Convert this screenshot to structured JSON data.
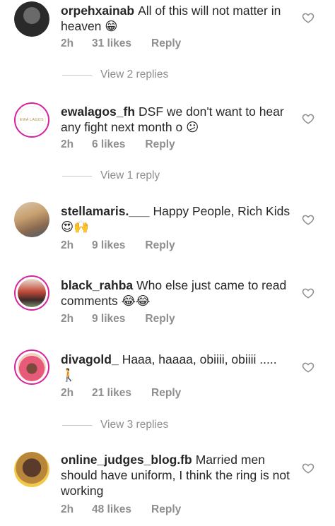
{
  "comments": [
    {
      "username": "orpehxainab",
      "text": "All of this will not matter in heaven",
      "emoji": "😁",
      "time": "2h",
      "likes": "31 likes",
      "reply": "Reply",
      "view_replies": "View 2 replies"
    },
    {
      "username": "ewalagos_fh",
      "text": "DSF we don't want to hear any fight next month o",
      "emoji": "😕",
      "avatar_text": "EWA LAGOS",
      "time": "2h",
      "likes": "6 likes",
      "reply": "Reply",
      "view_replies": "View 1 reply"
    },
    {
      "username": "stellamaris.___",
      "text": "Happy People, Rich Kids",
      "emoji": "😍🙌",
      "time": "2h",
      "likes": "9 likes",
      "reply": "Reply"
    },
    {
      "username": "black_rahba",
      "text": "Who else just came to read comments",
      "emoji": "😂😂",
      "time": "2h",
      "likes": "9 likes",
      "reply": "Reply"
    },
    {
      "username": "divagold_",
      "text": "Haaa, haaaa, obiiii, obiiii .....",
      "emoji": "🚶",
      "time": "2h",
      "likes": "21 likes",
      "reply": "Reply",
      "view_replies": "View 3 replies"
    },
    {
      "username": "online_judges_blog.fb",
      "text": "Married men should have uniform, I think the ring is not working",
      "time": "2h",
      "likes": "48 likes",
      "reply": "Reply"
    }
  ],
  "colors": {
    "text": "#262626",
    "meta": "#8e8e8e",
    "story_ring": "#d6249f"
  },
  "icons": {
    "like": "heart-outline-icon"
  }
}
